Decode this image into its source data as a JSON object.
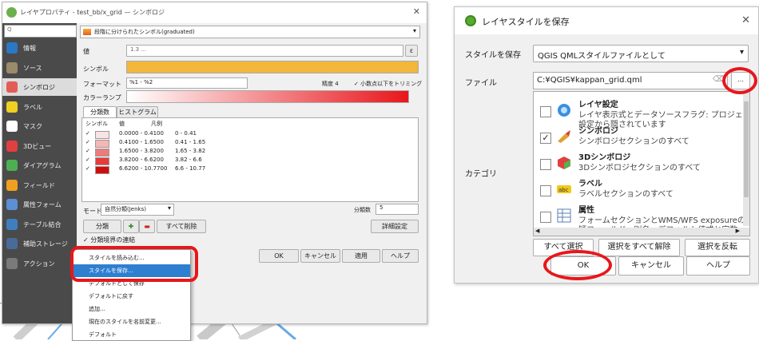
{
  "left_dialog": {
    "title": "レイヤプロパティ - test_bb/x_grid — シンボロジ",
    "search_placeholder": "Q",
    "sidebar": [
      {
        "label": "情報",
        "icon": "info-icon",
        "color": "#2b78c5"
      },
      {
        "label": "ソース",
        "icon": "source-icon",
        "color": "#9a8b6a"
      },
      {
        "label": "シンボロジ",
        "icon": "symbology-icon",
        "color": "#e25d56"
      },
      {
        "label": "ラベル",
        "icon": "label-icon",
        "color": "#f0d020"
      },
      {
        "label": "マスク",
        "icon": "mask-icon",
        "color": "#ffffff"
      },
      {
        "label": "3Dビュー",
        "icon": "3d-view-icon",
        "color": "#e04040"
      },
      {
        "label": "ダイアグラム",
        "icon": "diagram-icon",
        "color": "#4caf50"
      },
      {
        "label": "フィールド",
        "icon": "fields-icon",
        "color": "#f0a020"
      },
      {
        "label": "属性フォーム",
        "icon": "attribute-form-icon",
        "color": "#5b8fd6"
      },
      {
        "label": "テーブル結合",
        "icon": "joins-icon",
        "color": "#3f7fc0"
      },
      {
        "label": "補助ストレージ",
        "icon": "aux-storage-icon",
        "color": "#4a6a9a"
      },
      {
        "label": "アクション",
        "icon": "actions-icon",
        "color": "#7a7a7a"
      }
    ],
    "renderer": "段階に分けられたシンボル(graduated)",
    "value_label": "値",
    "value": "1.3  ...",
    "symbol_label": "シンボル",
    "format_label": "フォーマット",
    "format_value": "%1 - %2",
    "precision": "精度 4",
    "trim_label": "小数点以下をトリミング",
    "ramp_label": "カラーランプ",
    "tabs": [
      "分類数",
      "ヒストグラム"
    ],
    "table_headers": [
      "シンボル",
      "値",
      "凡例"
    ],
    "classes": [
      {
        "value": "0.0000 - 0.4100",
        "legend": "0 - 0.41",
        "color": "#fbe3e3"
      },
      {
        "value": "0.4100 - 1.6500",
        "legend": "0.41 - 1.65",
        "color": "#f7b5b5"
      },
      {
        "value": "1.6500 - 3.8200",
        "legend": "1.65 - 3.82",
        "color": "#f07a7a"
      },
      {
        "value": "3.8200 - 6.6200",
        "legend": "3.82 - 6.6",
        "color": "#e63b3b"
      },
      {
        "value": "6.6200 - 10.7700",
        "legend": "6.6 - 10.77",
        "color": "#d10c0c"
      }
    ],
    "mode_label": "モード",
    "mode_value": "自然分類(Jenks)",
    "classes_label": "分類数",
    "classes_count": "5",
    "classify_button": "分類",
    "delete_all_button": "すべて削除",
    "advanced_button": "詳細設定",
    "link_label": "分類境界の連結",
    "ok": "OK",
    "cancel": "キャンセル",
    "apply": "適用",
    "help": "ヘルプ"
  },
  "context_menu": [
    "スタイルを読み込む...",
    "スタイルを保存...",
    "デフォルトとして保存",
    "デフォルトに戻す",
    "追加...",
    "現在のスタイルを名前変更...",
    "デフォルト"
  ],
  "right_dialog": {
    "title": "レイヤスタイルを保存",
    "save_style_label": "スタイルを保存",
    "save_style_value": "QGIS QMLスタイルファイルとして",
    "file_label": "ファイル",
    "file_path": "C:¥QGIS¥kappan_grid.qml",
    "browse": "…",
    "category_label": "カテゴリ",
    "categories": [
      {
        "name": "レイヤ設定",
        "desc": "レイヤ表示式とデータソースフラグ: プロジェク",
        "desc2": "設定から隠されています",
        "checked": false,
        "icon": "layer-settings-icon"
      },
      {
        "name": "シンボロジ",
        "desc": "シンボロジセクションのすべて",
        "desc2": "",
        "checked": true,
        "icon": "symbology-brush-icon"
      },
      {
        "name": "3Dシンボロジ",
        "desc": "3Dシンボロジセクションのすべて",
        "desc2": "",
        "checked": false,
        "icon": "3d-cube-icon"
      },
      {
        "name": "ラベル",
        "desc": "ラベルセクションのすべて",
        "desc2": "",
        "checked": false,
        "icon": "abc-label-icon"
      },
      {
        "name": "属性",
        "desc": "フォームセクションとWMS/WFS exposureの",
        "desc2": "疑フィールド、別名、デフォルト値式と定数",
        "checked": false,
        "icon": "attribute-table-icon"
      }
    ],
    "select_all": "すべて選択",
    "deselect_all": "選択をすべて解除",
    "invert": "選択を反転",
    "ok": "OK",
    "cancel": "キャンセル",
    "help": "ヘルプ"
  },
  "colors": {
    "accent_red": "#e8161b",
    "selection_blue": "#2f7fd1",
    "ramp_start": "#ffffff",
    "ramp_end": "#e8161b",
    "symbol_orange": "#f2b63a"
  }
}
